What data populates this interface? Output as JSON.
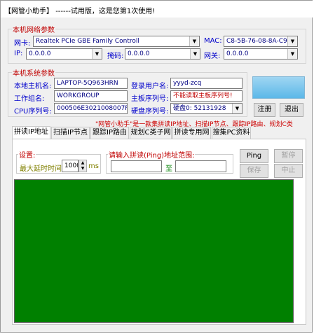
{
  "window": {
    "title_prefix": "【网管小助手】",
    "title_rest": "------试用版，这是您第1次使用!"
  },
  "network": {
    "group_title": "本机网络参数",
    "nic_label": "网卡:",
    "nic_value": "Realtek PCIe GBE Family Controll",
    "mac_label": "MAC:",
    "mac_value": "C8-5B-76-08-8A-C9",
    "ip_label": "IP:",
    "ip_value": "0.0.0.0",
    "mask_label": "掩码:",
    "mask_value": "0.0.0.0",
    "gateway_label": "网关:",
    "gateway_value": "0.0.0.0"
  },
  "system": {
    "group_title": "本机系统参数",
    "hostname_label": "本地主机名:",
    "hostname_value": "LAPTOP-5Q963HRN",
    "login_user_label": "登录用户名:",
    "login_user_value": "yyyd-zcq",
    "workgroup_label": "工作组名:",
    "workgroup_value": "WORKGROUP",
    "board_label": "主板序列号:",
    "board_value": "不能读取主板序列号!",
    "cpu_label": "CPU序列号:",
    "cpu_value": "000506E3021008007F",
    "disk_label": "硬盘序列号:",
    "disk_value": "硬盘0: 52131928"
  },
  "buttons": {
    "register": "注册",
    "exit": "退出",
    "ping": "Ping",
    "pause": "暂停",
    "save": "保存",
    "stop": "中止"
  },
  "marquee": "\"网管小助手\"是一款集拼读IP地址、扫描IP节点、跟踪IP路由、规划C类",
  "tabs": [
    "拼读IP地址",
    "扫描IP节点",
    "跟踪IP路由",
    "规划C类子网",
    "拼读专用网",
    "搜集PC资料"
  ],
  "settings": {
    "group_title": "设置:",
    "max_delay_label": "最大延时时间",
    "max_delay_value": "1000",
    "unit": "ms"
  },
  "range": {
    "group_title": "请输入拼读(Ping)地址范围:",
    "to_label": "至",
    "from_value": "",
    "to_value": ""
  },
  "colors": {
    "title_red": "#c00000",
    "label_blue": "#0000cc",
    "output_green": "#008000",
    "delay_olive": "#808000",
    "marquee_red": "#cc0000"
  }
}
